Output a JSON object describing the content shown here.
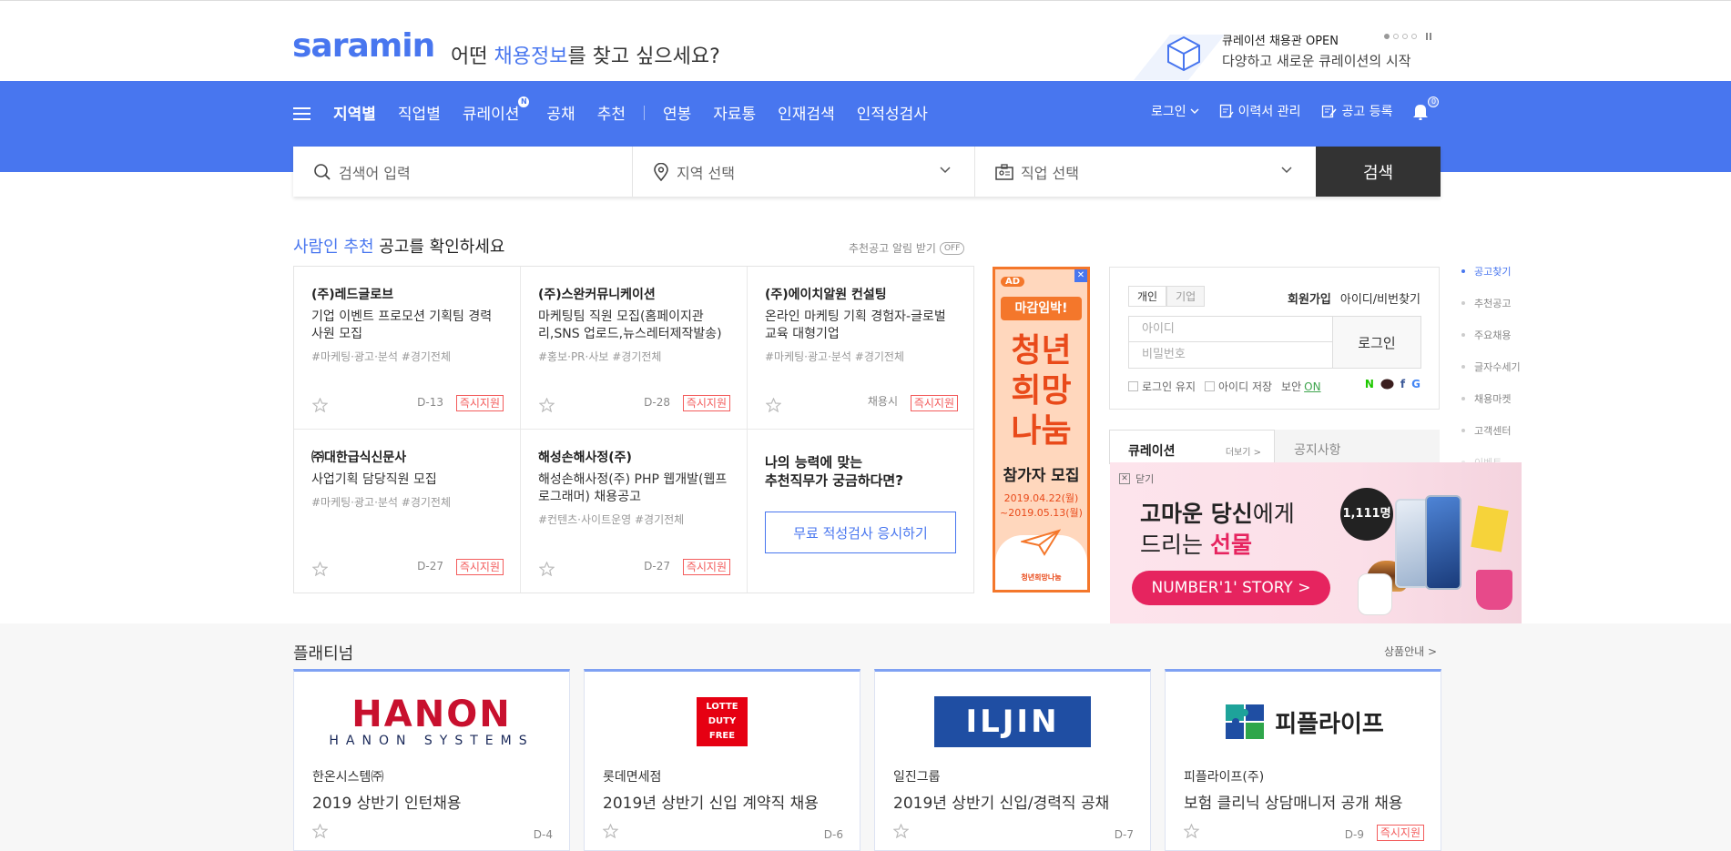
{
  "header": {
    "logo": "saramin",
    "tagline_pre": "어떤 ",
    "tagline_hl": "채용정보",
    "tagline_post": "를 찾고 싶으세요?",
    "promo_title": "큐레이션 채용관 OPEN",
    "promo_sub": "다양하고 새로운 큐레이션의 시작"
  },
  "nav": {
    "items": [
      {
        "label": "지역별"
      },
      {
        "label": "직업별"
      },
      {
        "label": "큐레이션",
        "badge": "N"
      },
      {
        "label": "공채"
      },
      {
        "label": "추천"
      },
      {
        "label": "연봉"
      },
      {
        "label": "자료통"
      },
      {
        "label": "인재검색"
      },
      {
        "label": "인적성검사"
      }
    ],
    "login": "로그인",
    "resume": "이력서 관리",
    "post": "공고 등록",
    "notify_count": "0"
  },
  "search": {
    "keyword_placeholder": "검색어 입력",
    "region_placeholder": "지역 선택",
    "job_placeholder": "직업 선택",
    "button": "검색"
  },
  "recommend": {
    "title_hl": "사람인 추천",
    "title_rest": " 공고를 확인하세요",
    "alarm": "추천공고 알림 받기",
    "alarm_toggle": "OFF",
    "cards": [
      {
        "company": "(주)레드글로브",
        "title": "기업 이벤트 프로모션 기획팀 경력사원 모집",
        "tags": "#마케팅·광고·분석 #경기전체",
        "dday": "D-13",
        "apply": "즉시지원"
      },
      {
        "company": "(주)스완커뮤니케이션",
        "title": "마케팅팀 직원 모집(홈페이지관리,SNS 업로드,뉴스레터제작발송)",
        "tags": "#홍보·PR·사보 #경기전체",
        "dday": "D-28",
        "apply": "즉시지원"
      },
      {
        "company": "(주)에이치알원 컨설팅",
        "title": "온라인 마케팅 기획 경험자-글로벌 교육 대형기업",
        "tags": "#마케팅·광고·분석 #경기전체",
        "dday": "채용시",
        "apply": "즉시지원"
      },
      {
        "company": "㈜대한급식신문사",
        "title": "사업기획 담당직원 모집",
        "tags": "#마케팅·광고·분석 #경기전체",
        "dday": "D-27",
        "apply": "즉시지원"
      },
      {
        "company": "해성손해사정(주)",
        "title": "해성손해사정(주) PHP 웹개발(웹프로그래머) 채용공고",
        "tags": "#컨텐츠·사이트운영 #경기전체",
        "dday": "D-27",
        "apply": "즉시지원"
      }
    ],
    "quiz_line1": "나의 능력에 맞는",
    "quiz_line2": "추천직무가 궁금하다면?",
    "quiz_button": "무료 적성검사 응시하기"
  },
  "vertical_ad": {
    "ad_label": "AD",
    "close": "✕",
    "tag": "마감임박!",
    "line1": "청년",
    "line2": "희망",
    "line3": "나눔",
    "sub": "참가자 모집",
    "date1": "2019.04.22(월)",
    "date2": "~2019.05.13(월)",
    "foot": "청년희망나눔"
  },
  "login_box": {
    "tab_personal": "개인",
    "tab_company": "기업",
    "signup": "회원가입",
    "find": "아이디/비번찾기",
    "id_placeholder": "아이디",
    "pw_placeholder": "비밀번호",
    "login_button": "로그인",
    "keep_login": "로그인 유지",
    "save_id": "아이디 저장",
    "security": "보안",
    "security_state": "ON"
  },
  "curation": {
    "tab1": "큐레이션",
    "more": "더보기 >",
    "tab2": "공지사항"
  },
  "side_nav": {
    "items": [
      "공고찾기",
      "추천공고",
      "주요채용",
      "글자수세기",
      "채용마켓",
      "고객센터",
      "이벤트"
    ]
  },
  "overlay_banner": {
    "close": "닫기",
    "line1_pre": "고마운 당신",
    "line1_post": "에게",
    "line2_pre": "드리는 ",
    "line2_hl": "선물",
    "cta": "NUMBER'1' STORY >",
    "count": "1,111명"
  },
  "platinum": {
    "title": "플래티넘",
    "more": "상품안내 >",
    "cards": [
      {
        "logo": "HANON SYSTEMS",
        "company": "한온시스템㈜",
        "title": "2019 상반기 인턴채용",
        "dday": "D-4"
      },
      {
        "logo": "LOTTE DUTY FREE",
        "company": "롯데면세점",
        "title": "2019년 상반기 신입 계약직 채용",
        "dday": "D-6"
      },
      {
        "logo": "ILJIN",
        "company": "일진그룹",
        "title": "2019년 상반기 신입/경력직 공채",
        "dday": "D-7"
      },
      {
        "logo": "피플라이프",
        "company": "피플라이프(주)",
        "title": "보험 클리닉 상담매니저 공개 채용",
        "dday": "D-9",
        "apply": "즉시지원"
      }
    ]
  },
  "colors": {
    "brand": "#4876ef",
    "apply": "#f35c5c",
    "search_button": "#333333"
  }
}
